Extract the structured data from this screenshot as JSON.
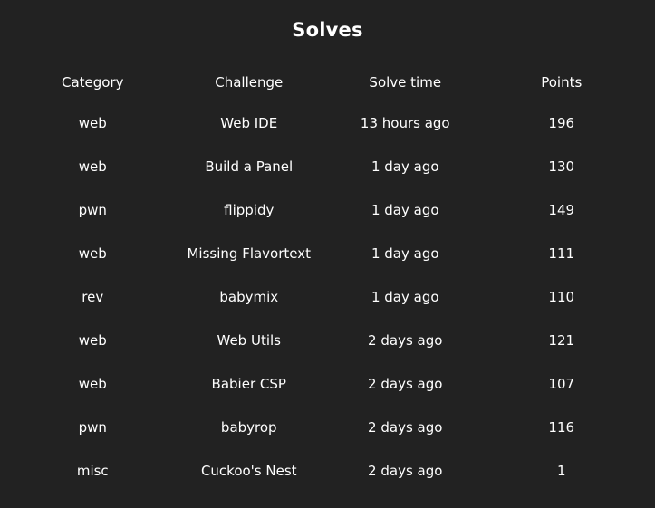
{
  "page": {
    "title": "Solves"
  },
  "table": {
    "headers": {
      "category": "Category",
      "challenge": "Challenge",
      "solve_time": "Solve time",
      "points": "Points"
    },
    "rows": [
      {
        "category": "web",
        "challenge": "Web IDE",
        "solve_time": "13 hours ago",
        "points": "196"
      },
      {
        "category": "web",
        "challenge": "Build a Panel",
        "solve_time": "1 day ago",
        "points": "130"
      },
      {
        "category": "pwn",
        "challenge": "flippidy",
        "solve_time": "1 day ago",
        "points": "149"
      },
      {
        "category": "web",
        "challenge": "Missing Flavortext",
        "solve_time": "1 day ago",
        "points": "111"
      },
      {
        "category": "rev",
        "challenge": "babymix",
        "solve_time": "1 day ago",
        "points": "110"
      },
      {
        "category": "web",
        "challenge": "Web Utils",
        "solve_time": "2 days ago",
        "points": "121"
      },
      {
        "category": "web",
        "challenge": "Babier CSP",
        "solve_time": "2 days ago",
        "points": "107"
      },
      {
        "category": "pwn",
        "challenge": "babyrop",
        "solve_time": "2 days ago",
        "points": "116"
      },
      {
        "category": "misc",
        "challenge": "Cuckoo's Nest",
        "solve_time": "2 days ago",
        "points": "1"
      }
    ]
  },
  "colors": {
    "background": "#222222",
    "text": "#ffffff",
    "divider": "#d9d9d9"
  }
}
